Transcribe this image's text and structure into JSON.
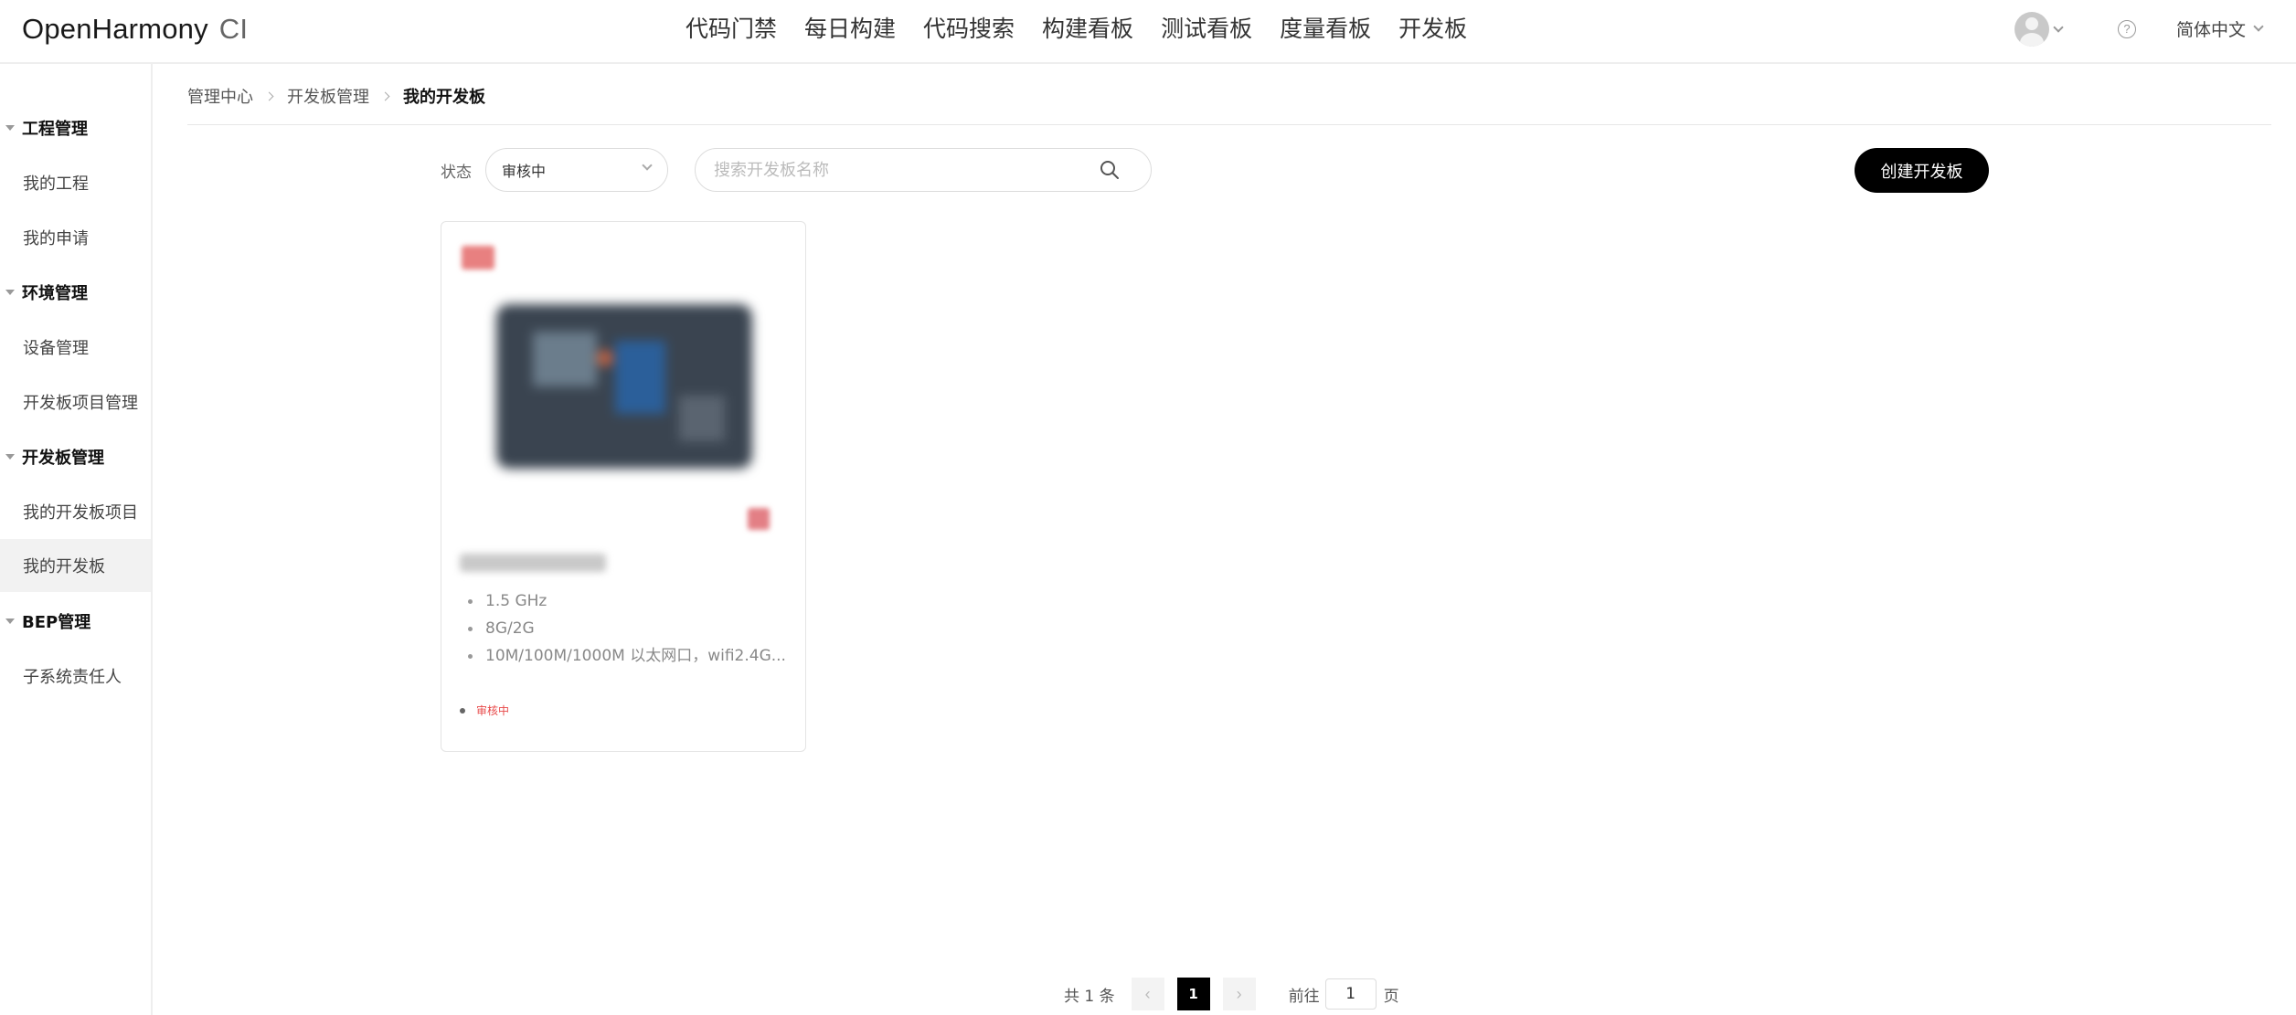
{
  "header": {
    "logo": "OpenHarmony",
    "logo_suffix": "CI",
    "nav": [
      "代码门禁",
      "每日构建",
      "代码搜索",
      "构建看板",
      "测试看板",
      "度量看板",
      "开发板"
    ],
    "help_symbol": "?",
    "language": "简体中文"
  },
  "sidebar": {
    "groups": [
      {
        "title": "工程管理",
        "items": [
          "我的工程",
          "我的申请"
        ]
      },
      {
        "title": "环境管理",
        "items": [
          "设备管理",
          "开发板项目管理"
        ]
      },
      {
        "title": "开发板管理",
        "items": [
          "我的开发板项目",
          "我的开发板"
        ]
      },
      {
        "title": "BEP管理",
        "items": [
          "子系统责任人"
        ]
      }
    ],
    "active_item": "我的开发板"
  },
  "breadcrumb": [
    "管理中心",
    "开发板管理",
    "我的开发板"
  ],
  "filters": {
    "status_label": "状态",
    "status_value": "审核中",
    "search_placeholder": "搜索开发板名称"
  },
  "create_button": "创建开发板",
  "cards": [
    {
      "specs": [
        "1.5 GHz",
        "8G/2G",
        "10M/100M/1000M 以太网口，wifi2.4G..."
      ],
      "status": "审核中"
    }
  ],
  "pagination": {
    "total_text": "共 1 条",
    "prev": "‹",
    "current_page": "1",
    "next": "›",
    "goto_label": "前往",
    "goto_value": "1",
    "page_suffix": "页"
  },
  "colors": {
    "primary": "#000000",
    "status_pending": "#e84a4a",
    "active_bg": "#f2f2f2"
  }
}
